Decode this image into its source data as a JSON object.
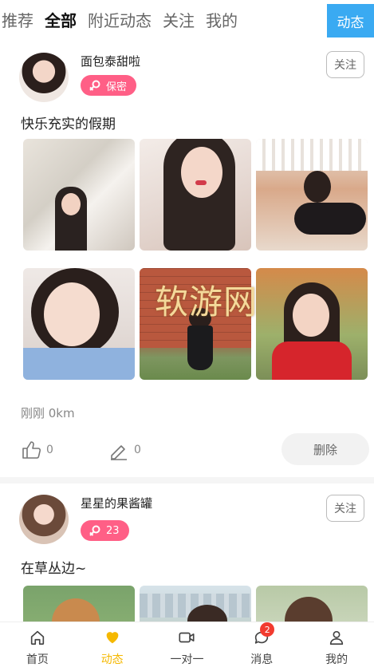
{
  "tabs": [
    "推荐",
    "全部",
    "附近动态",
    "关注",
    "我的"
  ],
  "active_tab": "全部",
  "post_button": "动态",
  "posts": [
    {
      "username": "面包泰甜啦",
      "badge": "保密",
      "follow": "关注",
      "text": "快乐充实的假期",
      "meta": "刚刚  0km",
      "likes": "0",
      "comments": "0",
      "delete": "删除"
    },
    {
      "username": "星星的果酱罐",
      "badge": "23",
      "follow": "关注",
      "text": "在草丛边~"
    }
  ],
  "watermark": "软游网",
  "nav": [
    {
      "label": "首页",
      "icon": "home-icon"
    },
    {
      "label": "动态",
      "icon": "heart-icon"
    },
    {
      "label": "一对一",
      "icon": "video-camera-icon"
    },
    {
      "label": "消息",
      "icon": "chat-bubble-icon",
      "badge": "2"
    },
    {
      "label": "我的",
      "icon": "user-icon"
    }
  ],
  "colors": {
    "accent_blue": "#3aaaf2",
    "badge_pink": "#ff5f86",
    "nav_active": "#f5b800",
    "msg_badge": "#f23b2f"
  }
}
